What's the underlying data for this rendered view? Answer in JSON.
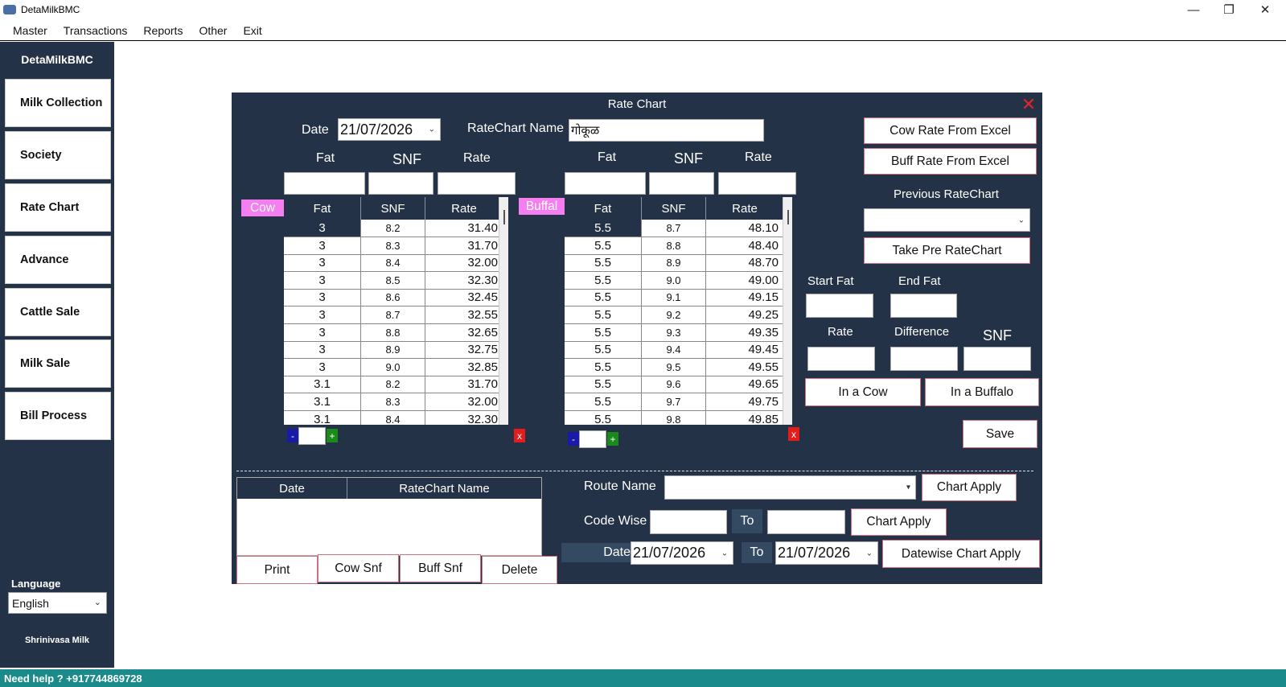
{
  "window": {
    "title": "DetaMilkBMC",
    "minimize": "—",
    "maximize": "❐",
    "close": "✕"
  },
  "menu": [
    "Master",
    "Transactions",
    "Reports",
    "Other",
    "Exit"
  ],
  "sidebar": {
    "brand": "DetaMilkBMC",
    "items": [
      "Milk Collection",
      "Society",
      "Rate Chart",
      "Advance",
      "Cattle Sale",
      "Milk Sale",
      "Bill Process"
    ],
    "language_label": "Language",
    "language_value": "English",
    "footer": "Shrinivasa Milk"
  },
  "status": {
    "help": "Need help ? +917744869728"
  },
  "panel": {
    "title": "Rate Chart",
    "date_label": "Date",
    "date_value": "21/07/2026",
    "ratechart_name_label": "RateChart Name",
    "ratechart_name_value": "गोकूळ",
    "cow": {
      "tag": "Cow",
      "fat_label": "Fat",
      "snf_label": "SNF",
      "rate_label": "Rate",
      "columns": [
        "Fat",
        "SNF",
        "Rate"
      ],
      "rows": [
        [
          "3",
          "8.2",
          "31.40"
        ],
        [
          "3",
          "8.3",
          "31.70"
        ],
        [
          "3",
          "8.4",
          "32.00"
        ],
        [
          "3",
          "8.5",
          "32.30"
        ],
        [
          "3",
          "8.6",
          "32.45"
        ],
        [
          "3",
          "8.7",
          "32.55"
        ],
        [
          "3",
          "8.8",
          "32.65"
        ],
        [
          "3",
          "8.9",
          "32.75"
        ],
        [
          "3",
          "9.0",
          "32.85"
        ],
        [
          "3.1",
          "8.2",
          "31.70"
        ],
        [
          "3.1",
          "8.3",
          "32.00"
        ],
        [
          "3.1",
          "8.4",
          "32.30"
        ]
      ]
    },
    "buffalo": {
      "tag": "Buffal",
      "fat_label": "Fat",
      "snf_label": "SNF",
      "rate_label": "Rate",
      "columns": [
        "Fat",
        "SNF",
        "Rate"
      ],
      "rows": [
        [
          "5.5",
          "8.7",
          "48.10"
        ],
        [
          "5.5",
          "8.8",
          "48.40"
        ],
        [
          "5.5",
          "8.9",
          "48.70"
        ],
        [
          "5.5",
          "9.0",
          "49.00"
        ],
        [
          "5.5",
          "9.1",
          "49.15"
        ],
        [
          "5.5",
          "9.2",
          "49.25"
        ],
        [
          "5.5",
          "9.3",
          "49.35"
        ],
        [
          "5.5",
          "9.4",
          "49.45"
        ],
        [
          "5.5",
          "9.5",
          "49.55"
        ],
        [
          "5.5",
          "9.6",
          "49.65"
        ],
        [
          "5.5",
          "9.7",
          "49.75"
        ],
        [
          "5.5",
          "9.8",
          "49.85"
        ]
      ]
    },
    "mini": {
      "minus": "-",
      "plus": "+",
      "remove": "x"
    },
    "right": {
      "cow_excel": "Cow Rate From Excel",
      "buff_excel": "Buff Rate From Excel",
      "previous_label": "Previous RateChart",
      "take_pre": "Take Pre RateChart",
      "start_fat": "Start Fat",
      "end_fat": "End Fat",
      "rate": "Rate",
      "difference": "Difference",
      "snf": "SNF",
      "in_cow": "In a Cow",
      "in_buffalo": "In a Buffalo",
      "save": "Save"
    },
    "list": {
      "columns": [
        "Date",
        "RateChart Name"
      ]
    },
    "bottom_buttons": [
      "Print",
      "Cow Snf",
      "Buff Snf",
      "Delete"
    ],
    "route_label": "Route Name",
    "chart_apply": "Chart Apply",
    "code_wise_label": "Code Wise",
    "to_label": "To",
    "date_label2": "Date",
    "date_from": "21/07/2026",
    "date_to": "21/07/2026",
    "datewise_apply": "Datewise Chart Apply"
  }
}
